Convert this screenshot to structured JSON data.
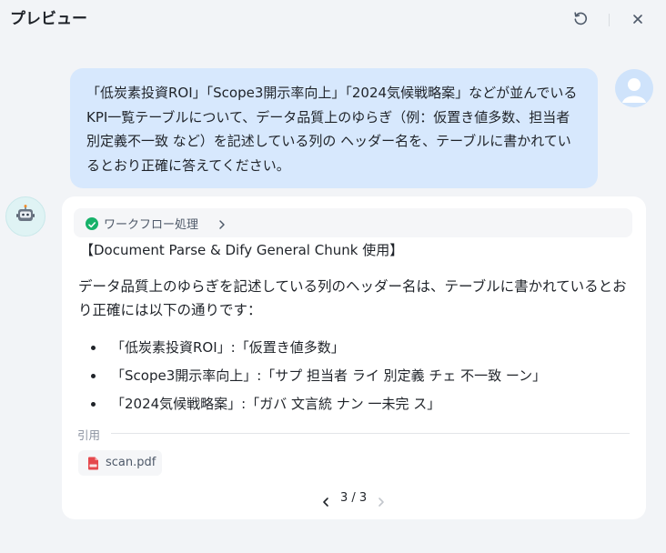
{
  "header": {
    "title": "プレビュー",
    "icons": [
      "refresh-icon",
      "close-icon"
    ]
  },
  "conversation": {
    "user_message": "「低炭素投資ROI」「Scope3開示率向上」「2024気候戦略案」などが並んでいる KPI一覧テーブルについて、データ品質上のゆらぎ（例：仮置き値多数、担当者別定義不一致 など）を記述している列の ヘッダー名を、テーブルに書かれているとおり正確に答えてください。",
    "bot": {
      "workflow_label": "ワークフロー処理",
      "workflow_status": "success",
      "doc_title": "【Document Parse & Dify General Chunk 使用】",
      "answer_intro": "データ品質上のゆらぎを記述している列のヘッダー名は、テーブルに書かれているとおり正確には以下の通りです：",
      "answer_items": [
        "「低炭素投資ROI」:「仮置き値多数」",
        "「Scope3開示率向上」:「サプ 担当者 ライ 別定義 チェ 不一致 ーン」",
        "「2024気候戦略案」:「ガバ 文言統 ナン 一未完 ス」"
      ],
      "citation_label": "引用",
      "citations": [
        {
          "name": "scan.pdf",
          "icon": "pdf-file-icon"
        }
      ],
      "pager": "3 / 3"
    }
  },
  "colors": {
    "page_bg": "#f2f4f7",
    "user_bubble": "#d7e8fd",
    "success": "#17b26a",
    "pdf_red": "#e5484d"
  }
}
